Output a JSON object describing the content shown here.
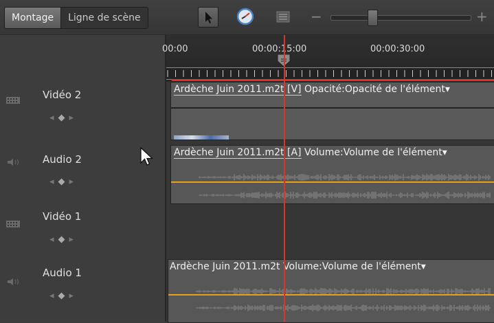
{
  "toolbar": {
    "tabs": [
      {
        "label": "Montage",
        "active": true
      },
      {
        "label": "Ligne de scène",
        "active": false
      }
    ],
    "tools": [
      "selection-arrow-icon",
      "clock-icon",
      "list-view-icon"
    ],
    "zoom": {
      "minus": "−",
      "plus": "+",
      "level": 0.28
    }
  },
  "timecodes": [
    "00:00",
    "00:00:15:00",
    "00:00:30:00"
  ],
  "tracks": [
    {
      "name": "Vidéo 2",
      "kind": "video"
    },
    {
      "name": "Audio 2",
      "kind": "audio"
    },
    {
      "name": "Vidéo 1",
      "kind": "video"
    },
    {
      "name": "Audio 1",
      "kind": "audio"
    }
  ],
  "keyframe_nav": {
    "prev": "◂",
    "add": "◆",
    "next": "▸"
  },
  "clips": {
    "video2": {
      "name": "Ardèche Juin 2011.m2t [V]",
      "effect": "Opacité:Opacité de l'élément",
      "dropdown": "▾"
    },
    "audio2": {
      "name": "Ardèche Juin 2011.m2t [A]",
      "effect": "Volume:Volume de l'élément",
      "dropdown": "▾"
    },
    "audio1": {
      "name": "Ardèche Juin 2011.m2t",
      "effect": "Volume:Volume de l'élément",
      "dropdown": "▾"
    }
  },
  "colors": {
    "playhead": "#e0312a",
    "volume_line": "#e8a21a"
  }
}
